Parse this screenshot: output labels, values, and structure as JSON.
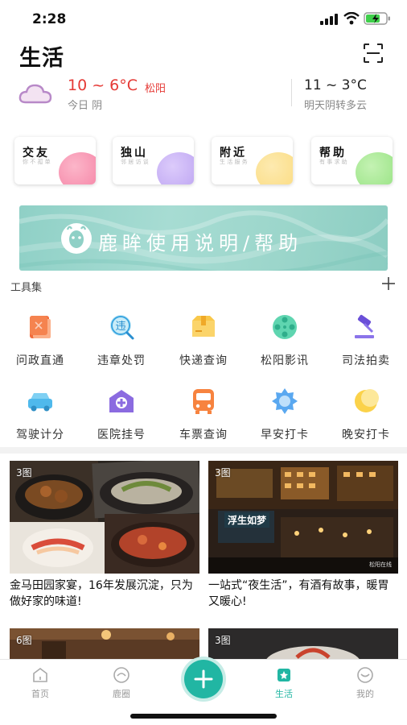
{
  "status": {
    "time": "2:28"
  },
  "header": {
    "title": "生活"
  },
  "weather": {
    "today_temp": "10 ~ 6°C",
    "city": "松阳",
    "today_desc": "今日 阴",
    "tomorrow_temp": "11 ~ 3°C",
    "tomorrow_desc": "明天阴转多云"
  },
  "cards": [
    {
      "title": "交友",
      "sub": "你 不 孤 单",
      "color": "#f47ba0"
    },
    {
      "title": "独山",
      "sub": "邻 居 访 谈",
      "color": "#b79df0"
    },
    {
      "title": "附近",
      "sub": "生 活 服 务",
      "color": "#fbd978"
    },
    {
      "title": "帮助",
      "sub": "有 事 求 助",
      "color": "#8fe07a"
    }
  ],
  "banner": {
    "text": "鹿眸使用说明/帮助"
  },
  "tools": {
    "title": "工具集",
    "items": [
      {
        "label": "问政直通",
        "icon": "book-icon"
      },
      {
        "label": "违章处罚",
        "icon": "violation-search-icon"
      },
      {
        "label": "快递查询",
        "icon": "parcel-icon"
      },
      {
        "label": "松阳影讯",
        "icon": "film-reel-icon"
      },
      {
        "label": "司法拍卖",
        "icon": "auction-hammer-icon"
      },
      {
        "label": "驾驶计分",
        "icon": "car-icon"
      },
      {
        "label": "医院挂号",
        "icon": "hospital-icon"
      },
      {
        "label": "车票查询",
        "icon": "bus-icon"
      },
      {
        "label": "早安打卡",
        "icon": "sun-icon"
      },
      {
        "label": "晚安打卡",
        "icon": "moon-icon"
      }
    ]
  },
  "feed": [
    {
      "badge": "3图",
      "title": "金马田园家宴，16年发展沉淀，只为做好家的味道!"
    },
    {
      "badge": "3图",
      "title": "一站式“夜生活”，有酒有故事，暖胃又暖心!",
      "sign": "浮生如梦",
      "watermark": "松阳在线"
    },
    {
      "badge": "6图"
    },
    {
      "badge": "3图"
    }
  ],
  "tabs": [
    {
      "label": "首页",
      "icon": "home-icon"
    },
    {
      "label": "鹿圈",
      "icon": "deer-circle-icon"
    },
    {
      "label": "生活",
      "icon": "life-star-icon",
      "active": true
    },
    {
      "label": "我的",
      "icon": "profile-icon"
    }
  ],
  "colors": {
    "accent": "#21b6a3",
    "temp_red": "#e53935"
  }
}
